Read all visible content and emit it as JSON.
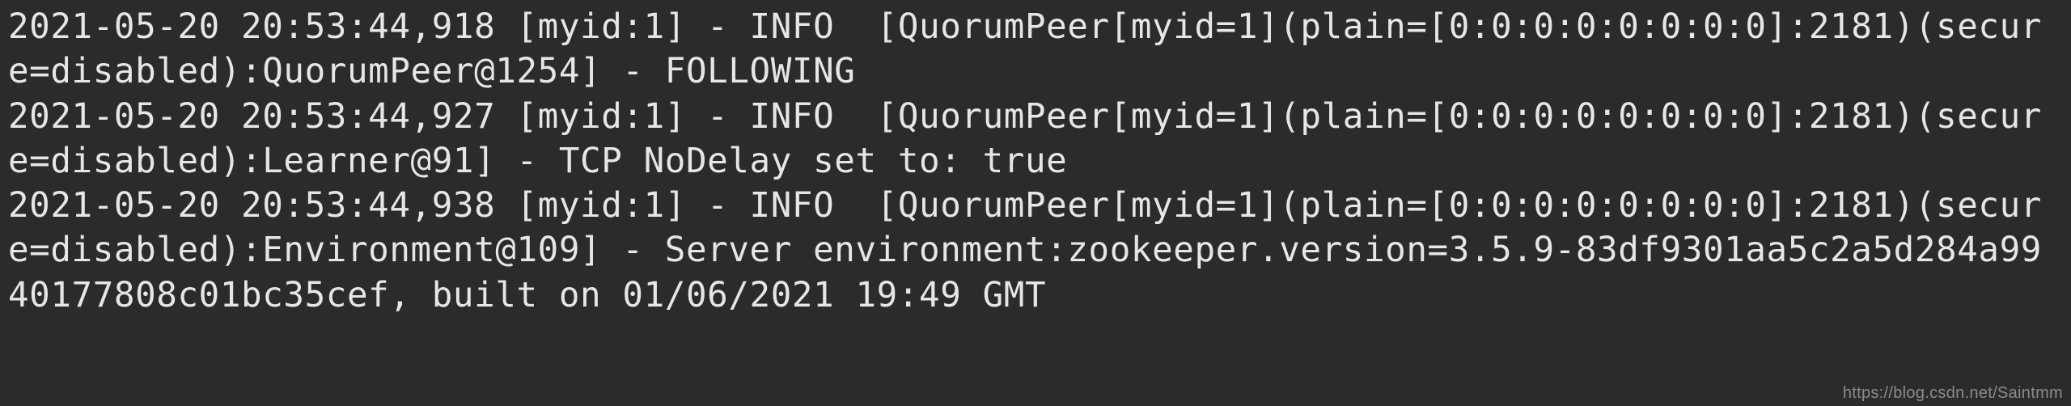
{
  "log": {
    "lines": [
      "2021-05-20 20:53:44,918 [myid:1] - INFO  [QuorumPeer[myid=1](plain=[0:0:0:0:0:0:0:0]:2181)(secure=disabled):QuorumPeer@1254] - FOLLOWING",
      "2021-05-20 20:53:44,927 [myid:1] - INFO  [QuorumPeer[myid=1](plain=[0:0:0:0:0:0:0:0]:2181)(secure=disabled):Learner@91] - TCP NoDelay set to: true",
      "2021-05-20 20:53:44,938 [myid:1] - INFO  [QuorumPeer[myid=1](plain=[0:0:0:0:0:0:0:0]:2181)(secure=disabled):Environment@109] - Server environment:zookeeper.version=3.5.9-83df9301aa5c2a5d284a9940177808c01bc35cef, built on 01/06/2021 19:49 GMT"
    ]
  },
  "watermark": {
    "text": "https://blog.csdn.net/Saintmm"
  }
}
